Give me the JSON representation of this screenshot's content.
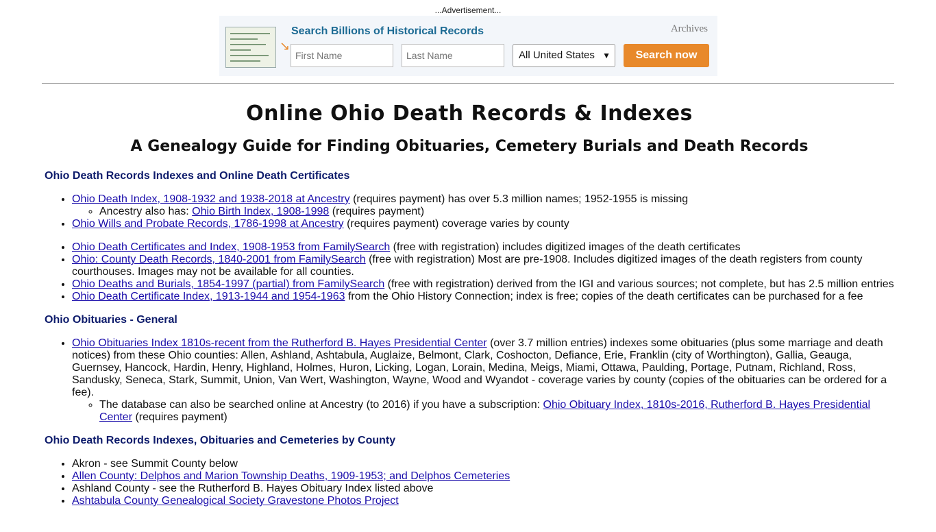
{
  "ad": {
    "label": "...Advertisement...",
    "title": "Search Billions of Historical Records",
    "brand": "Archives",
    "first_name_placeholder": "First Name",
    "last_name_placeholder": "Last Name",
    "location_selected": "All United States",
    "search_button": "Search now"
  },
  "page": {
    "title": "Online Ohio Death Records & Indexes",
    "subtitle": "A Genealogy Guide for Finding Obituaries, Cemetery Burials and Death Records"
  },
  "sections": [
    {
      "heading": "Ohio Death Records Indexes and Online Death Certificates",
      "items": [
        {
          "link": "Ohio Death Index, 1908-1932 and 1938-2018 at Ancestry",
          "text": " (requires payment) has over 5.3 million names; 1952-1955 is missing",
          "sub": [
            {
              "prefix": "Ancestry also has: ",
              "link": "Ohio Birth Index, 1908-1998",
              "text": " (requires payment)"
            }
          ]
        },
        {
          "link": "Ohio Wills and Probate Records, 1786-1998 at Ancestry",
          "text": " (requires payment) coverage varies by county"
        },
        {
          "link": "Ohio Death Certificates and Index, 1908-1953 from FamilySearch",
          "text": " (free with registration) includes digitized images of the death certificates"
        },
        {
          "link": "Ohio: County Death Records, 1840-2001 from FamilySearch",
          "text": " (free with registration) Most are pre-1908. Includes digitized images of the death registers from county courthouses. Images may not be available for all counties."
        },
        {
          "link": "Ohio Deaths and Burials, 1854-1997 (partial) from FamilySearch",
          "text": " (free with registration) derived from the IGI and various sources; not complete, but has 2.5 million entries"
        },
        {
          "link": "Ohio Death Certificate Index, 1913-1944 and 1954-1963",
          "text": " from the Ohio History Connection; index is free; copies of the death certificates can be purchased for a fee"
        }
      ]
    },
    {
      "heading": "Ohio Obituaries - General",
      "items": [
        {
          "link": "Ohio Obituaries Index 1810s-recent from the Rutherford B. Hayes Presidential Center",
          "text": " (over 3.7 million entries) indexes some obituaries (plus some marriage and death notices) from these Ohio counties: Allen, Ashland, Ashtabula, Auglaize, Belmont, Clark, Coshocton, Defiance, Erie, Franklin (city of Worthington), Gallia, Geauga, Guernsey, Hancock, Hardin, Henry, Highland, Holmes, Huron, Licking, Logan, Lorain, Medina, Meigs, Miami, Ottawa, Paulding, Portage, Putnam, Richland, Ross, Sandusky, Seneca, Stark, Summit, Union, Van Wert, Washington, Wayne, Wood and Wyandot - coverage varies by county (copies of the obituaries can be ordered for a fee).",
          "sub": [
            {
              "prefix": "The database can also be searched online at Ancestry (to 2016) if you have a subscription: ",
              "link": "Ohio Obituary Index, 1810s-2016, Rutherford B. Hayes Presidential Center",
              "text": " (requires payment)"
            }
          ]
        }
      ]
    },
    {
      "heading": "Ohio Death Records Indexes, Obituaries and Cemeteries by County",
      "items": [
        {
          "plain": "Akron - see Summit County below"
        },
        {
          "link": "Allen County: Delphos and Marion Township Deaths, 1909-1953; and Delphos Cemeteries",
          "text": ""
        },
        {
          "plain": "Ashland County - see the Rutherford B. Hayes Obituary Index listed above"
        },
        {
          "link": "Ashtabula County Genealogical Society Gravestone Photos Project",
          "text": ""
        }
      ]
    }
  ]
}
